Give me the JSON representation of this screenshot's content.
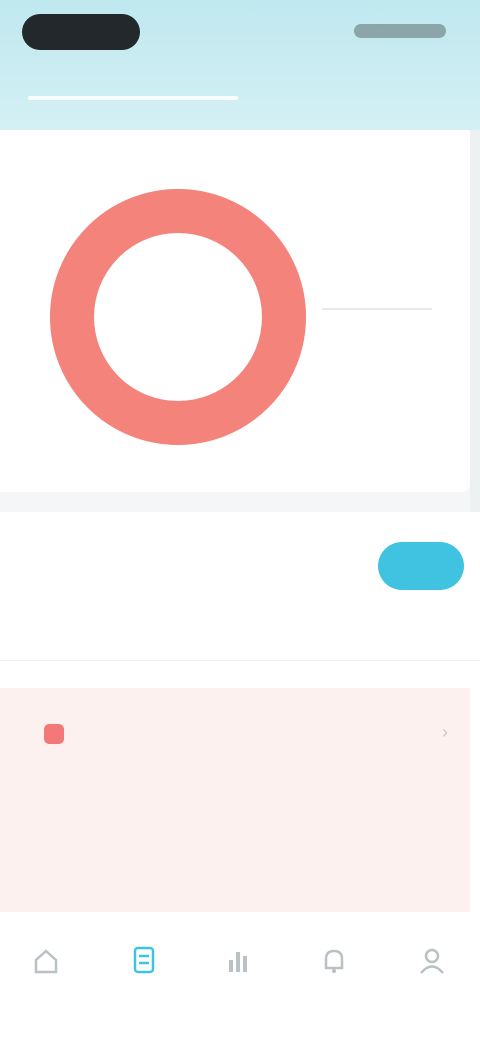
{
  "header": {
    "tabs": [
      {
        "label": "",
        "active": true
      },
      {
        "label": "",
        "active": false
      }
    ]
  },
  "ring_card": {
    "title": "",
    "center_label": "",
    "legend_label": "",
    "ring_color": "#f4837c",
    "ring_fill_fraction": 1.0
  },
  "record": {
    "title": "",
    "button_label": "",
    "filters": [
      "",
      "",
      ""
    ],
    "entry": {
      "type_label": "",
      "value": "",
      "meta_left": "",
      "meta_right": "",
      "accent_color": "#f2787a"
    }
  },
  "nav": {
    "items": [
      {
        "icon": "home-icon",
        "label": "",
        "active": false
      },
      {
        "icon": "record-icon",
        "label": "",
        "active": true
      },
      {
        "icon": "chart-icon",
        "label": "",
        "active": false
      },
      {
        "icon": "bell-icon",
        "label": "",
        "active": false
      },
      {
        "icon": "profile-icon",
        "label": "",
        "active": false
      }
    ]
  },
  "colors": {
    "accent": "#3fc3e0",
    "header_bg": "#c8edf2",
    "entry_bg": "#fdf1f0"
  }
}
